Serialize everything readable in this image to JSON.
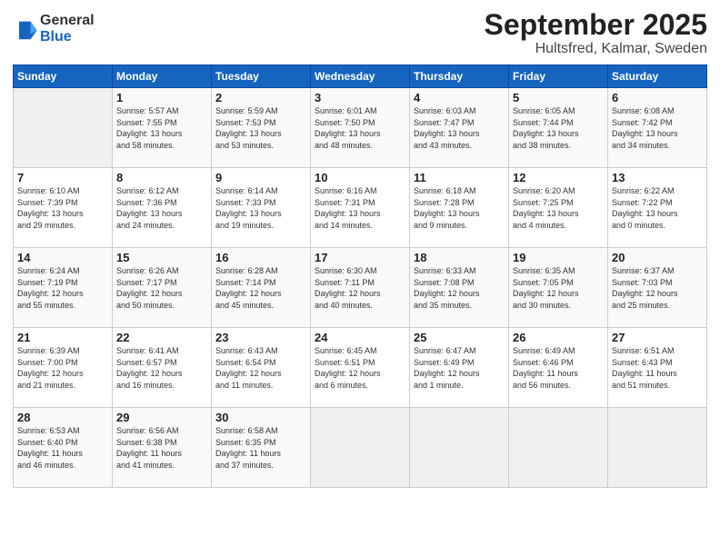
{
  "logo": {
    "general": "General",
    "blue": "Blue"
  },
  "title": "September 2025",
  "location": "Hultsfred, Kalmar, Sweden",
  "days_of_week": [
    "Sunday",
    "Monday",
    "Tuesday",
    "Wednesday",
    "Thursday",
    "Friday",
    "Saturday"
  ],
  "weeks": [
    [
      {
        "day": "",
        "info": ""
      },
      {
        "day": "1",
        "info": "Sunrise: 5:57 AM\nSunset: 7:55 PM\nDaylight: 13 hours\nand 58 minutes."
      },
      {
        "day": "2",
        "info": "Sunrise: 5:59 AM\nSunset: 7:53 PM\nDaylight: 13 hours\nand 53 minutes."
      },
      {
        "day": "3",
        "info": "Sunrise: 6:01 AM\nSunset: 7:50 PM\nDaylight: 13 hours\nand 48 minutes."
      },
      {
        "day": "4",
        "info": "Sunrise: 6:03 AM\nSunset: 7:47 PM\nDaylight: 13 hours\nand 43 minutes."
      },
      {
        "day": "5",
        "info": "Sunrise: 6:05 AM\nSunset: 7:44 PM\nDaylight: 13 hours\nand 38 minutes."
      },
      {
        "day": "6",
        "info": "Sunrise: 6:08 AM\nSunset: 7:42 PM\nDaylight: 13 hours\nand 34 minutes."
      }
    ],
    [
      {
        "day": "7",
        "info": "Sunrise: 6:10 AM\nSunset: 7:39 PM\nDaylight: 13 hours\nand 29 minutes."
      },
      {
        "day": "8",
        "info": "Sunrise: 6:12 AM\nSunset: 7:36 PM\nDaylight: 13 hours\nand 24 minutes."
      },
      {
        "day": "9",
        "info": "Sunrise: 6:14 AM\nSunset: 7:33 PM\nDaylight: 13 hours\nand 19 minutes."
      },
      {
        "day": "10",
        "info": "Sunrise: 6:16 AM\nSunset: 7:31 PM\nDaylight: 13 hours\nand 14 minutes."
      },
      {
        "day": "11",
        "info": "Sunrise: 6:18 AM\nSunset: 7:28 PM\nDaylight: 13 hours\nand 9 minutes."
      },
      {
        "day": "12",
        "info": "Sunrise: 6:20 AM\nSunset: 7:25 PM\nDaylight: 13 hours\nand 4 minutes."
      },
      {
        "day": "13",
        "info": "Sunrise: 6:22 AM\nSunset: 7:22 PM\nDaylight: 13 hours\nand 0 minutes."
      }
    ],
    [
      {
        "day": "14",
        "info": "Sunrise: 6:24 AM\nSunset: 7:19 PM\nDaylight: 12 hours\nand 55 minutes."
      },
      {
        "day": "15",
        "info": "Sunrise: 6:26 AM\nSunset: 7:17 PM\nDaylight: 12 hours\nand 50 minutes."
      },
      {
        "day": "16",
        "info": "Sunrise: 6:28 AM\nSunset: 7:14 PM\nDaylight: 12 hours\nand 45 minutes."
      },
      {
        "day": "17",
        "info": "Sunrise: 6:30 AM\nSunset: 7:11 PM\nDaylight: 12 hours\nand 40 minutes."
      },
      {
        "day": "18",
        "info": "Sunrise: 6:33 AM\nSunset: 7:08 PM\nDaylight: 12 hours\nand 35 minutes."
      },
      {
        "day": "19",
        "info": "Sunrise: 6:35 AM\nSunset: 7:05 PM\nDaylight: 12 hours\nand 30 minutes."
      },
      {
        "day": "20",
        "info": "Sunrise: 6:37 AM\nSunset: 7:03 PM\nDaylight: 12 hours\nand 25 minutes."
      }
    ],
    [
      {
        "day": "21",
        "info": "Sunrise: 6:39 AM\nSunset: 7:00 PM\nDaylight: 12 hours\nand 21 minutes."
      },
      {
        "day": "22",
        "info": "Sunrise: 6:41 AM\nSunset: 6:57 PM\nDaylight: 12 hours\nand 16 minutes."
      },
      {
        "day": "23",
        "info": "Sunrise: 6:43 AM\nSunset: 6:54 PM\nDaylight: 12 hours\nand 11 minutes."
      },
      {
        "day": "24",
        "info": "Sunrise: 6:45 AM\nSunset: 6:51 PM\nDaylight: 12 hours\nand 6 minutes."
      },
      {
        "day": "25",
        "info": "Sunrise: 6:47 AM\nSunset: 6:49 PM\nDaylight: 12 hours\nand 1 minute."
      },
      {
        "day": "26",
        "info": "Sunrise: 6:49 AM\nSunset: 6:46 PM\nDaylight: 11 hours\nand 56 minutes."
      },
      {
        "day": "27",
        "info": "Sunrise: 6:51 AM\nSunset: 6:43 PM\nDaylight: 11 hours\nand 51 minutes."
      }
    ],
    [
      {
        "day": "28",
        "info": "Sunrise: 6:53 AM\nSunset: 6:40 PM\nDaylight: 11 hours\nand 46 minutes."
      },
      {
        "day": "29",
        "info": "Sunrise: 6:56 AM\nSunset: 6:38 PM\nDaylight: 11 hours\nand 41 minutes."
      },
      {
        "day": "30",
        "info": "Sunrise: 6:58 AM\nSunset: 6:35 PM\nDaylight: 11 hours\nand 37 minutes."
      },
      {
        "day": "",
        "info": ""
      },
      {
        "day": "",
        "info": ""
      },
      {
        "day": "",
        "info": ""
      },
      {
        "day": "",
        "info": ""
      }
    ]
  ]
}
